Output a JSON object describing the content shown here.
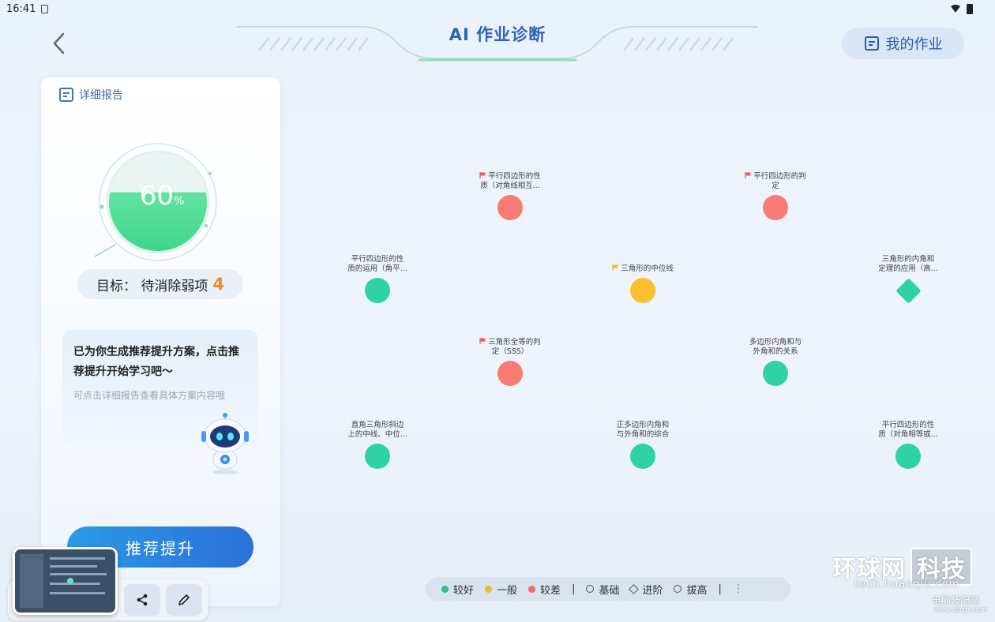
{
  "status": {
    "time": "16:41"
  },
  "header": {
    "title": "AI 作业诊断",
    "my_homework": "我的作业"
  },
  "panel": {
    "report_link": "详细报告",
    "gauge_value": "60",
    "gauge_unit": "%",
    "gauge_fraction": 0.6,
    "goal_label": "目标：  待消除弱项",
    "goal_count": "4",
    "reco_title": "已为你生成推荐提升方案，点击推荐提升开始学习吧～",
    "reco_sub": "可点击详细报告查看具体方案内容哦",
    "promote_button": "推荐提升"
  },
  "colors": {
    "good": "#2ed3a2",
    "medium": "#fbc02d",
    "poor": "#f97c74",
    "accent": "#2b70d8"
  },
  "nodes": [
    {
      "label": "平行四边形的性质（对角线相互...",
      "status": "poor",
      "shape": "circle",
      "flag": "red"
    },
    {
      "label": "平行四边形的判定",
      "status": "poor",
      "shape": "circle",
      "flag": "red"
    },
    {
      "label": "平行四边形的性质的运用（角平...",
      "status": "good",
      "shape": "circle",
      "flag": ""
    },
    {
      "label": "三角形的中位线",
      "status": "medium",
      "shape": "circle",
      "flag": "yellow"
    },
    {
      "label": "三角形的内角和定理的应用（高...",
      "status": "good",
      "shape": "diamond",
      "flag": ""
    },
    {
      "label": "三角形全等的判定（SSS）",
      "status": "poor",
      "shape": "circle",
      "flag": "red"
    },
    {
      "label": "多边形内角和与外角和的关系",
      "status": "good",
      "shape": "circle",
      "flag": ""
    },
    {
      "label": "直角三角形斜边上的中线、中位...",
      "status": "good",
      "shape": "circle",
      "flag": ""
    },
    {
      "label": "正多边形内角和与外角和的综合",
      "status": "good",
      "shape": "circle",
      "flag": ""
    },
    {
      "label": "平行四边形的性质（对角相等或...",
      "status": "good",
      "shape": "circle",
      "flag": ""
    }
  ],
  "node_labels_split": [
    [
      "平行四边形的性",
      "质（对角线相互..."
    ],
    [
      "平行四边形的判",
      "定"
    ],
    [
      "平行四边形的性",
      "质的运用（角平..."
    ],
    [
      "三角形的中位线",
      ""
    ],
    [
      "三角形的内角和",
      "定理的应用（高..."
    ],
    [
      "三角形全等的判",
      "定（SSS）"
    ],
    [
      "多边形内角和与",
      "外角和的关系"
    ],
    [
      "直角三角形斜边",
      "上的中线、中位..."
    ],
    [
      "正多边形内角和",
      "与外角和的综合"
    ],
    [
      "平行四边形的性",
      "质（对角相等或..."
    ]
  ],
  "legend": {
    "good": "较好",
    "medium": "一般",
    "poor": "较差",
    "basic": "基础",
    "advanced": "进阶",
    "elevate": "拔高"
  },
  "watermark": {
    "logo_a": "环球网",
    "logo_b": "科技",
    "url": "tech.huanqiu.com",
    "dnzp": "电脑装配网",
    "dnzp_url": "www.dnzp.com"
  }
}
